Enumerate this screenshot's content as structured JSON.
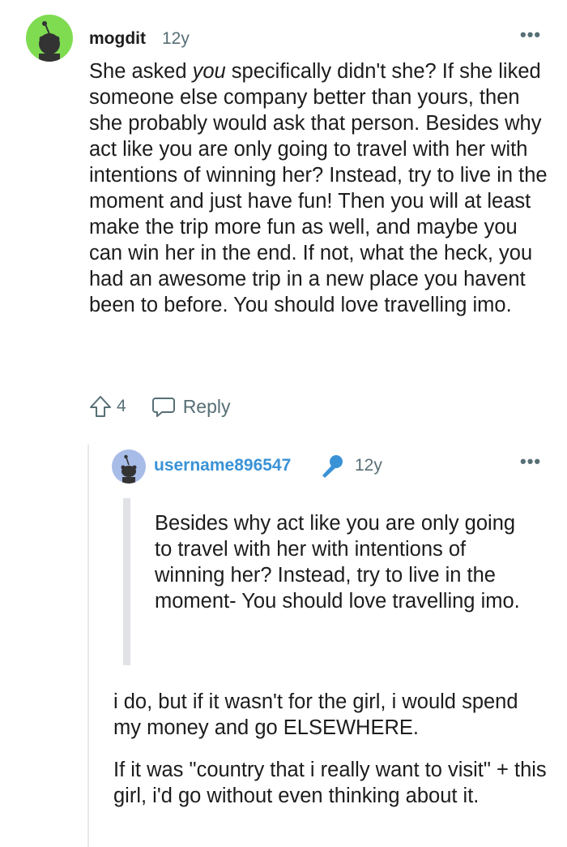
{
  "comment": {
    "author": "mogdit",
    "age": "12y",
    "body_pre": "She asked ",
    "body_em": "you",
    "body_post": " specifically didn't she? If she liked someone else company better than yours, then she probably would ask that person. Besides why act like you are only going to travel with her with intentions of winning her? Instead, try to live in the moment and just have fun! Then you will at least make the trip more fun as well, and maybe you can win her in the end. If not, what the heck, you had an awesome trip in a new place you havent been to before. You should love travelling imo.",
    "votes": "4",
    "reply_label": "Reply",
    "more": "•••"
  },
  "reply": {
    "author": "username896547",
    "age": "12y",
    "more": "•••",
    "quote": "Besides why act like you are only going to travel with her with intentions of winning her? Instead, try to live in the moment- You should love travelling imo.",
    "paragraph1": "i do, but if it wasn't for the girl, i would spend my money and go ELSEWHERE.",
    "paragraph2": "If it was \"country that i really want to visit\" + this girl, i'd go without even thinking about it."
  },
  "colors": {
    "top_avatar_bg": "#7fdc51",
    "reply_avatar_bg": "#a8bce8",
    "op_username": "#3a92d6",
    "mic_badge": "#3a92d6",
    "muted": "#576f76"
  },
  "icons": {
    "top_avatar": "snoo-avatar-icon",
    "reply_avatar": "snoo-avatar-icon",
    "upvote": "upvote-arrow-icon",
    "reply": "speech-bubble-icon",
    "badge": "microphone-icon"
  }
}
